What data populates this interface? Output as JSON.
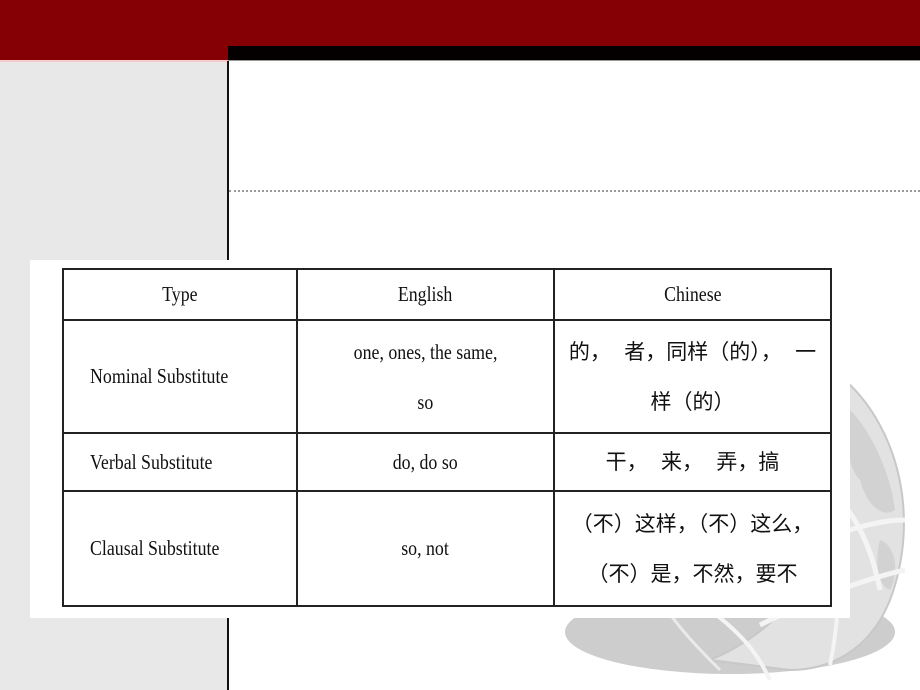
{
  "slide": {
    "theme": {
      "header_color": "#850005",
      "band_color": "#050000",
      "sidebar_color": "#e8e8e8",
      "globe_color": "#cfcfcf"
    },
    "decor": {
      "globe_icon": "globe-icon"
    }
  },
  "table": {
    "headers": [
      "Type",
      "English",
      "Chinese"
    ],
    "rows": [
      {
        "type": "Nominal Substitute",
        "english": [
          "one, ones, the same,",
          "so"
        ],
        "chinese": [
          "的，  者，同样（的），  一",
          "样（的）"
        ]
      },
      {
        "type": "Verbal Substitute",
        "english": [
          "do, do so"
        ],
        "chinese": [
          "干，  来，  弄，搞"
        ]
      },
      {
        "type": "Clausal Substitute",
        "english": [
          "so, not"
        ],
        "chinese": [
          "（不）这样，（不）这么，",
          "（不）是，不然，要不"
        ]
      }
    ]
  }
}
